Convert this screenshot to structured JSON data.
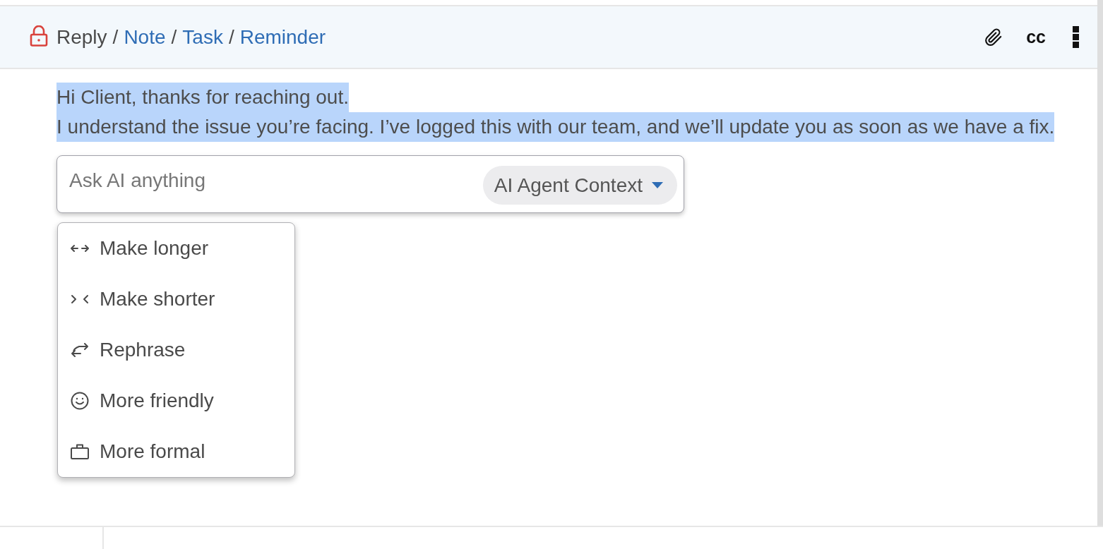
{
  "composer": {
    "modes": [
      {
        "label": "Reply",
        "selected": true
      },
      {
        "label": "Note",
        "selected": false
      },
      {
        "label": "Task",
        "selected": false
      },
      {
        "label": "Reminder",
        "selected": false
      }
    ],
    "separators": [
      "/",
      "/",
      "/"
    ],
    "cc_label": "cc"
  },
  "message": {
    "lines": [
      {
        "text": "Hi Client, thanks for reaching out.",
        "selected": true
      },
      {
        "text": "I understand the issue you’re facing. I’ve logged this with our team, and we’ll update you as soon as we have a fix.",
        "selected": true
      }
    ]
  },
  "ai_prompt": {
    "placeholder": "Ask AI anything",
    "context_dropdown": "AI Agent Context"
  },
  "ai_menu": {
    "items": [
      {
        "kind": "lengthen",
        "label": "Make longer"
      },
      {
        "kind": "shorten",
        "label": "Make shorter"
      },
      {
        "kind": "rephrase",
        "label": "Rephrase"
      },
      {
        "kind": "friendly",
        "label": "More friendly"
      },
      {
        "kind": "formal",
        "label": "More formal"
      }
    ]
  }
}
